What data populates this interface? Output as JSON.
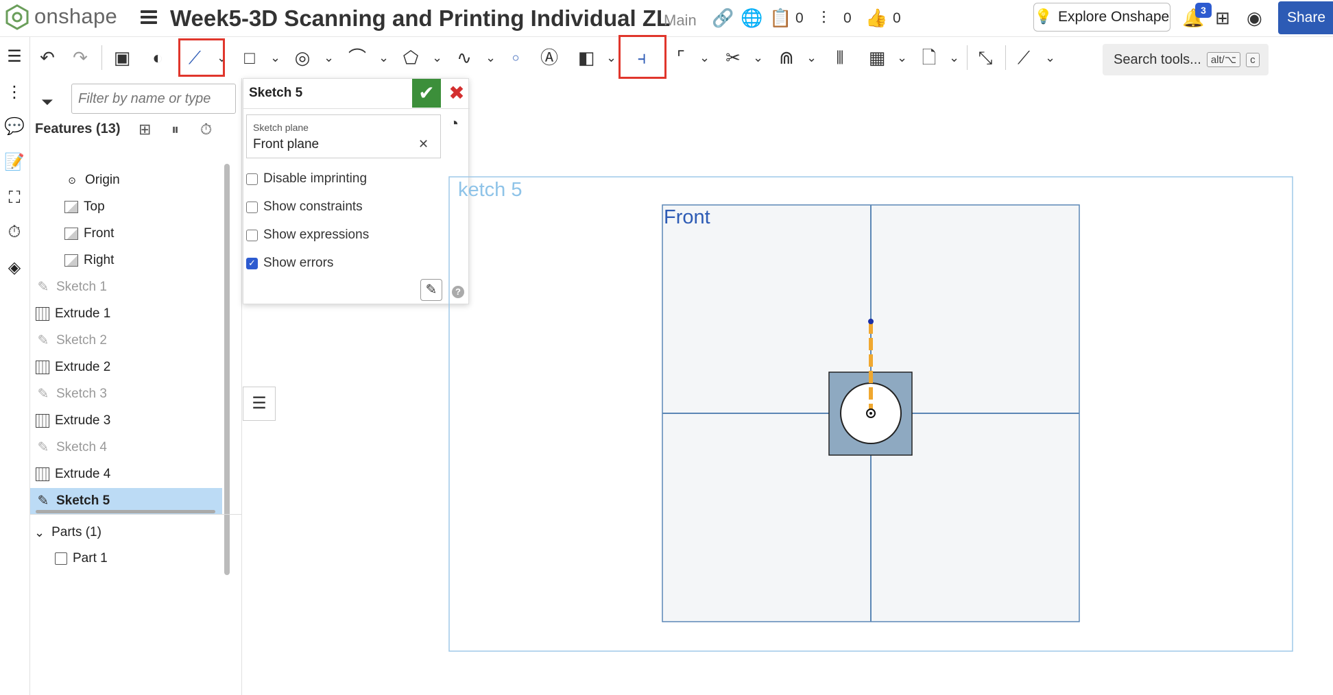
{
  "header": {
    "brand": "onshape",
    "doc_title": "Week5-3D Scanning and Printing Individual ZL",
    "branch": "Main",
    "versions_count": "0",
    "branches_count": "0",
    "likes_count": "0",
    "explore_label": "Explore Onshape",
    "notifications_count": "3",
    "share_label": "Share"
  },
  "toolbar": {
    "search_label": "Search tools...",
    "search_shortcut_1": "alt/⌥",
    "search_shortcut_2": "c",
    "highlighted_tools": [
      "line-tool",
      "align-constraint-tool"
    ],
    "highlight_color": "#e0362c"
  },
  "feature_panel": {
    "filter_placeholder": "Filter by name or type",
    "features_header": "Features (13)",
    "items": [
      {
        "label": "Origin",
        "type": "origin",
        "indent": 1,
        "dim": false,
        "selected": false
      },
      {
        "label": "Top",
        "type": "plane",
        "indent": 1,
        "dim": false,
        "selected": false
      },
      {
        "label": "Front",
        "type": "plane",
        "indent": 1,
        "dim": false,
        "selected": false
      },
      {
        "label": "Right",
        "type": "plane",
        "indent": 1,
        "dim": false,
        "selected": false
      },
      {
        "label": "Sketch 1",
        "type": "sketch",
        "indent": 0,
        "dim": true,
        "selected": false
      },
      {
        "label": "Extrude 1",
        "type": "extrude",
        "indent": 0,
        "dim": false,
        "selected": false
      },
      {
        "label": "Sketch 2",
        "type": "sketch",
        "indent": 0,
        "dim": true,
        "selected": false
      },
      {
        "label": "Extrude 2",
        "type": "extrude",
        "indent": 0,
        "dim": false,
        "selected": false
      },
      {
        "label": "Sketch 3",
        "type": "sketch",
        "indent": 0,
        "dim": true,
        "selected": false
      },
      {
        "label": "Extrude 3",
        "type": "extrude",
        "indent": 0,
        "dim": false,
        "selected": false
      },
      {
        "label": "Sketch 4",
        "type": "sketch",
        "indent": 0,
        "dim": true,
        "selected": false
      },
      {
        "label": "Extrude 4",
        "type": "extrude",
        "indent": 0,
        "dim": false,
        "selected": false
      },
      {
        "label": "Sketch 5",
        "type": "sketch",
        "indent": 0,
        "dim": false,
        "selected": true
      }
    ],
    "parts_header": "Parts (1)",
    "parts": [
      "Part 1"
    ],
    "selected_color": "#bcdbf5"
  },
  "sketch_dialog": {
    "title": "Sketch 5",
    "plane_label": "Sketch plane",
    "plane_value": "Front plane",
    "options": [
      {
        "label": "Disable imprinting",
        "checked": false
      },
      {
        "label": "Show constraints",
        "checked": false
      },
      {
        "label": "Show expressions",
        "checked": false
      },
      {
        "label": "Show errors",
        "checked": true
      }
    ],
    "ok_color": "#3c8f3a",
    "cancel_color": "#d32f2f"
  },
  "viewport": {
    "sketch_label": "ketch 5",
    "plane_label": "Front",
    "plane_label_color": "#2d5bb5",
    "sketch_label_color": "#8ec3e8",
    "part_fill": "#8ea9c1",
    "construction_line_color": "#f0a830"
  }
}
